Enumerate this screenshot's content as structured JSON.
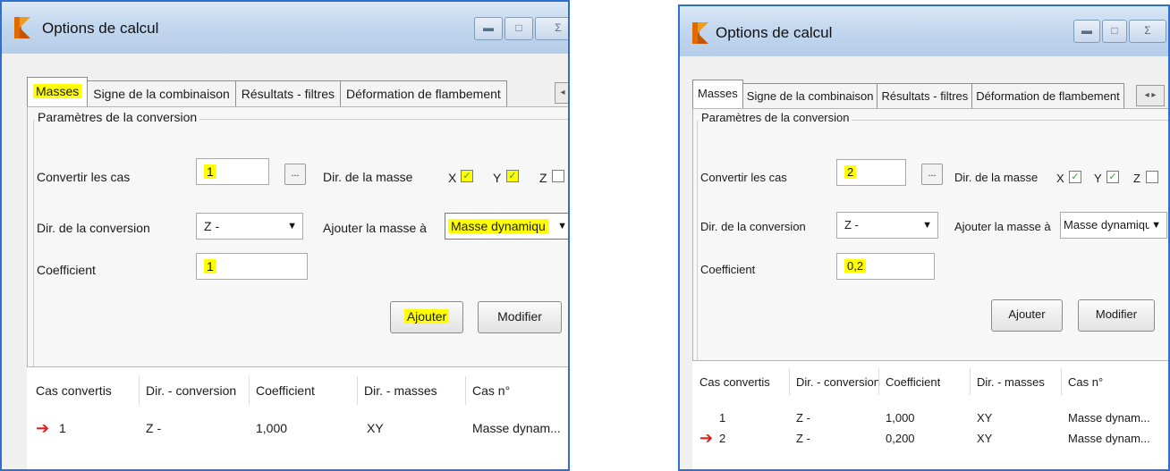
{
  "left": {
    "title": "Options de calcul",
    "window_buttons": {
      "minimize": "▬",
      "maximize": "□",
      "close": "Σ"
    },
    "tabs": [
      "Masses",
      "Signe de la combinaison",
      "Résultats - filtres",
      "Déformation de flambement"
    ],
    "tab_scroll": "◂",
    "group_title": "Paramètres de la conversion",
    "convert_label": "Convertir les cas",
    "convert_value": "1",
    "browse": "...",
    "mass_dir_label": "Dir. de la masse",
    "x_label": "X",
    "y_label": "Y",
    "z_label": "Z",
    "x_checked": "✓",
    "y_checked": "✓",
    "z_checked": "",
    "conv_dir_label": "Dir. de la conversion",
    "conv_dir_value": "Z -",
    "add_mass_label": "Ajouter la masse à",
    "add_mass_value": "Masse dynamiqu",
    "coef_label": "Coefficient",
    "coef_value": "1",
    "add_button": "Ajouter",
    "modify_button": "Modifier",
    "headers": [
      "Cas convertis",
      "Dir. - conversion",
      "Coefficient",
      "Dir. - masses",
      "Cas n°"
    ],
    "rows": [
      {
        "arrow": "➔",
        "case": "1",
        "dir": "Z -",
        "coef": "1,000",
        "masses": "XY",
        "type": "Masse dynam..."
      }
    ]
  },
  "right": {
    "title": "Options de calcul",
    "window_buttons": {
      "minimize": "▬",
      "maximize": "□",
      "close": "Σ"
    },
    "tabs": [
      "Masses",
      "Signe de la combinaison",
      "Résultats - filtres",
      "Déformation de flambement"
    ],
    "tab_scroll": "◂ ▸",
    "group_title": "Paramètres de la conversion",
    "convert_label": "Convertir les cas",
    "convert_value": "2",
    "browse": "...",
    "mass_dir_label": "Dir. de la masse",
    "x_label": "X",
    "y_label": "Y",
    "z_label": "Z",
    "x_checked": "✓",
    "y_checked": "✓",
    "z_checked": "",
    "conv_dir_label": "Dir. de la conversion",
    "conv_dir_value": "Z -",
    "add_mass_label": "Ajouter la masse à",
    "add_mass_value": "Masse dynamiqu",
    "coef_label": "Coefficient",
    "coef_value": "0,2",
    "add_button": "Ajouter",
    "modify_button": "Modifier",
    "headers": [
      "Cas convertis",
      "Dir. - conversion",
      "Coefficient",
      "Dir. - masses",
      "Cas n°"
    ],
    "rows": [
      {
        "arrow": "",
        "case": "1",
        "dir": "Z -",
        "coef": "1,000",
        "masses": "XY",
        "type": "Masse dynam..."
      },
      {
        "arrow": "➔",
        "case": "2",
        "dir": "Z -",
        "coef": "0,200",
        "masses": "XY",
        "type": "Masse dynam..."
      }
    ]
  },
  "colors": {
    "highlight": "#ffff00",
    "window_border": "#2f6fd0",
    "arrow": "#e02020"
  }
}
